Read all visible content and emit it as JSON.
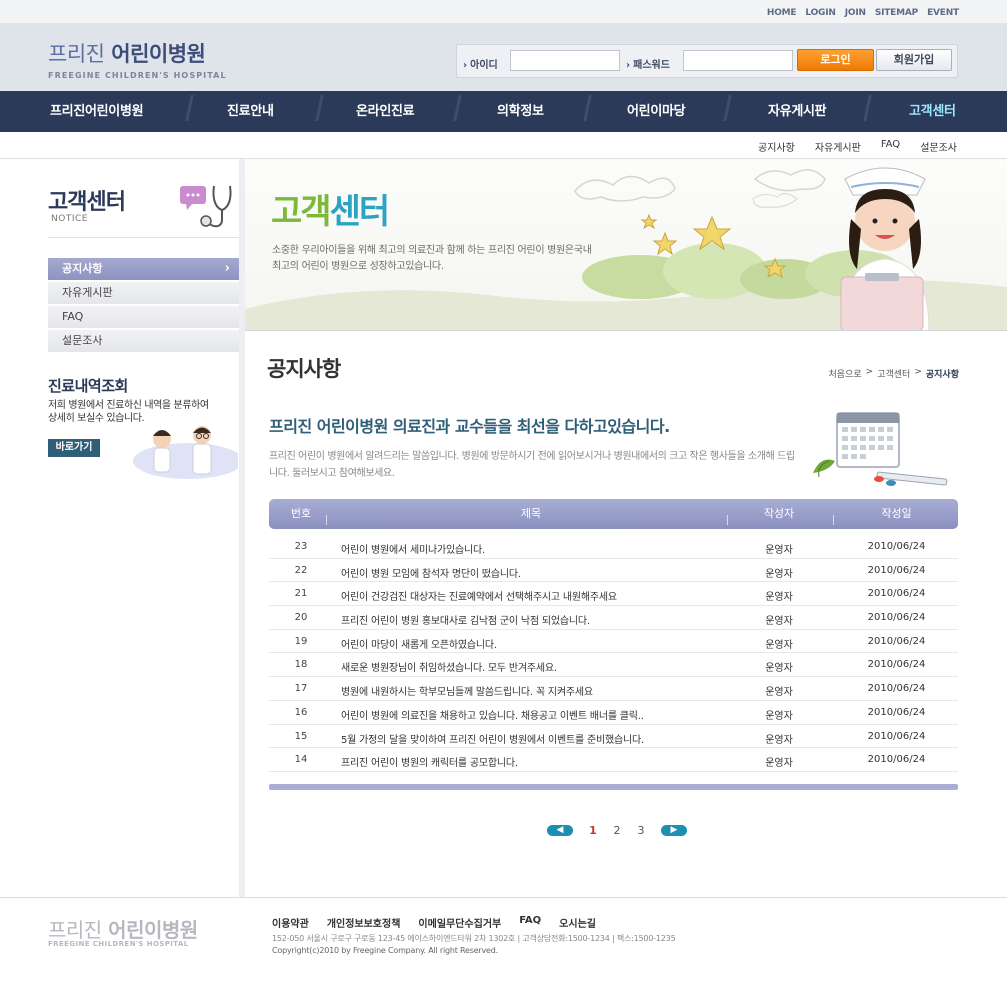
{
  "util": {
    "links": [
      "HOME",
      "LOGIN",
      "JOIN",
      "SITEMAP",
      "EVENT"
    ]
  },
  "header": {
    "logo_kor_1": "프리진",
    "logo_kor_2": "어린이병원",
    "logo_eng": "FREEGINE CHILDREN'S HOSPITAL",
    "id_label": "아이디",
    "pw_label": "패스워드",
    "id_value": "",
    "pw_value": "",
    "login_btn": "로그인",
    "join_btn": "회원가입"
  },
  "gnb": {
    "items": [
      "프리진어린이병원",
      "진료안내",
      "온라인진료",
      "의학정보",
      "어린이마당",
      "자유게시판",
      "고객센터"
    ],
    "active_index": 6
  },
  "subnav": {
    "items": [
      "공지사항",
      "자유게시판",
      "FAQ",
      "설문조사"
    ]
  },
  "lnb": {
    "title": "고객센터",
    "subtitle": "NOTICE",
    "menu": [
      "공지사항",
      "자유게시판",
      "FAQ",
      "설문조사"
    ],
    "active_index": 0,
    "history_title": "진료내역조회",
    "history_desc": "저희 병원에서 진료하신 내역을 분류하여 상세히 보실수 있습니다.",
    "history_btn": "바로가기"
  },
  "banner": {
    "title_1": "고객",
    "title_2": "센터",
    "desc": "소중한 우리아이들을 위해 최고의 의료진과 함께 하는 프리진 어린이 병원은국내 최고의 어린이 병원으로 성장하고있습니다."
  },
  "content": {
    "page_title": "공지사항",
    "breadcrumb": [
      "처음으로",
      "고객센터",
      "공지사항"
    ],
    "intro_title": "프리진 어린이병원 의료진과 교수들을 최선을 다하고있습니다.",
    "intro_desc": "프리진 어린이 병원에서 알려드리는 말씀입니다. 병원에 방문하시기 전에 읽어보시거나 병원내에서의 크고 작은 행사들을 소개해 드립니다. 둘러보시고 참여해보세요.",
    "columns": [
      "번호",
      "제목",
      "작성자",
      "작성일"
    ],
    "rows": [
      {
        "no": "23",
        "subject": "어린이 병원에서 세미나가있습니다.",
        "author": "운영자",
        "date": "2010/06/24"
      },
      {
        "no": "22",
        "subject": "어린이 병원 모임에 참석자 명단이 떴습니다.",
        "author": "운영자",
        "date": "2010/06/24"
      },
      {
        "no": "21",
        "subject": "어린이 건강검진 대상자는 진료예약에서 선택해주시고 내원해주세요",
        "author": "운영자",
        "date": "2010/06/24"
      },
      {
        "no": "20",
        "subject": "프리진 어린이 병원 홍보대사로 김낙점 군이 낙점 되었습니다.",
        "author": "운영자",
        "date": "2010/06/24"
      },
      {
        "no": "19",
        "subject": "어린이 마당이 새롭게 오픈하였습니다.",
        "author": "운영자",
        "date": "2010/06/24"
      },
      {
        "no": "18",
        "subject": "새로운 병원장님이 취임하셨습니다. 모두 반겨주세요.",
        "author": "운영자",
        "date": "2010/06/24"
      },
      {
        "no": "17",
        "subject": "병원에 내원하시는 학부모님들께 말씀드립니다. 꼭 지켜주세요",
        "author": "운영자",
        "date": "2010/06/24"
      },
      {
        "no": "16",
        "subject": "어린이 병원에 의료진을 채용하고 있습니다. 채용공고 이벤트 배너를 클릭..",
        "author": "운영자",
        "date": "2010/06/24"
      },
      {
        "no": "15",
        "subject": "5월 가정의 달을 맞이하여 프리진 어린이 병원에서 이벤트를 준비했습니다.",
        "author": "운영자",
        "date": "2010/06/24"
      },
      {
        "no": "14",
        "subject": "프리진 어린이 병원의 캐릭터를 공모합니다.",
        "author": "운영자",
        "date": "2010/06/24"
      }
    ],
    "pages": [
      "1",
      "2",
      "3"
    ],
    "current_page": "1"
  },
  "footer": {
    "logo_kor_1": "프리진",
    "logo_kor_2": "어린이병원",
    "logo_eng": "FREEGINE CHILDREN'S HOSPITAL",
    "links": [
      "이용약관",
      "개인정보보호정책",
      "이메일무단수집거부",
      "FAQ",
      "오시는길"
    ],
    "address": "152-050 서울시 구로구 구로동 123-45 에이스하이엔드타워 2차 1302호  |  고객상담전화:1500-1234  |  팩스:1500-1235",
    "copyright": "Copyright(c)2010 by Freegine Company. All right Reserved."
  },
  "colors": {
    "navy": "#2c3a5a",
    "accent_cyan": "#9be8ff",
    "login_orange": "#f07a00",
    "table_head": "#8a90bf",
    "teal": "#2f5f78"
  }
}
